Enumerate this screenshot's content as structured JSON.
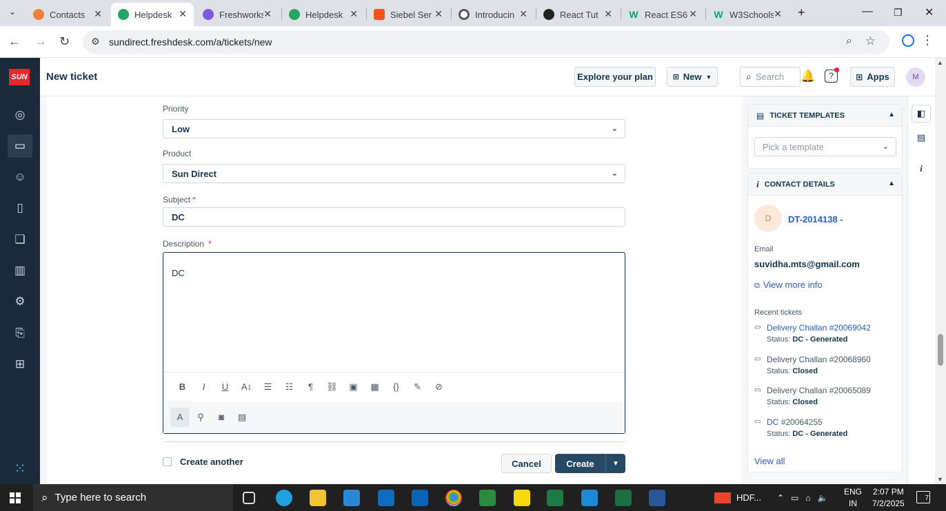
{
  "browser": {
    "tabs": [
      {
        "title": "Contacts",
        "color": "#f47e3c"
      },
      {
        "title": "Helpdesk",
        "color": "#25a55f"
      },
      {
        "title": "Freshworks",
        "color": "#7b5ce1"
      },
      {
        "title": "Helpdesk",
        "color": "#25a55f"
      },
      {
        "title": "Siebel Ser",
        "color": "#f4511e"
      },
      {
        "title": "Introducin",
        "color": "#555555"
      },
      {
        "title": "React Tut",
        "color": "#222222"
      },
      {
        "title": "React ES6",
        "color": "#04aa6d"
      },
      {
        "title": "W3Schools",
        "color": "#04aa6d"
      }
    ],
    "url": "sundirect.freshdesk.com/a/tickets/new"
  },
  "header": {
    "title": "New ticket",
    "explore_label": "Explore your plan",
    "new_label": "New",
    "search_placeholder": "Search",
    "apps_label": "Apps",
    "avatar_initial": "M"
  },
  "brand": {
    "logo_text": "SUN",
    "accent": "#e8262d"
  },
  "form": {
    "priority": {
      "label": "Priority",
      "value": "Low"
    },
    "product": {
      "label": "Product",
      "value": "Sun Direct"
    },
    "subject": {
      "label": "Subject",
      "value": "DC",
      "required": "*"
    },
    "description": {
      "label": "Description",
      "value": "DC",
      "required": "*"
    },
    "create_another_label": "Create another",
    "cancel_label": "Cancel",
    "create_label": "Create"
  },
  "templates": {
    "title": "TICKET TEMPLATES",
    "placeholder": "Pick a template"
  },
  "contact": {
    "title": "CONTACT DETAILS",
    "initial": "D",
    "name": "DT-2014138 -",
    "email_label": "Email",
    "email": "suvidha.mts@gmail.com",
    "view_more": "View more info",
    "recent_label": "Recent tickets",
    "status_label": "Status:",
    "tickets": [
      {
        "subject": "Delivery Challan",
        "number": "#20069042",
        "status": "DC - Generated"
      },
      {
        "subject": "Delivery Challan",
        "number": "#20068960",
        "status": "Closed"
      },
      {
        "subject": "Delivery Challan",
        "number": "#20065089",
        "status": "Closed"
      },
      {
        "subject": "DC",
        "number": "#20064255",
        "status": "DC - Generated"
      }
    ],
    "view_all": "View all"
  },
  "taskbar": {
    "search_placeholder": "Type here to search",
    "hdf_label": "HDF...",
    "lang_line1": "ENG",
    "lang_line2": "IN",
    "time": "2:07 PM",
    "date": "7/2/2025",
    "notification_count": "7"
  }
}
